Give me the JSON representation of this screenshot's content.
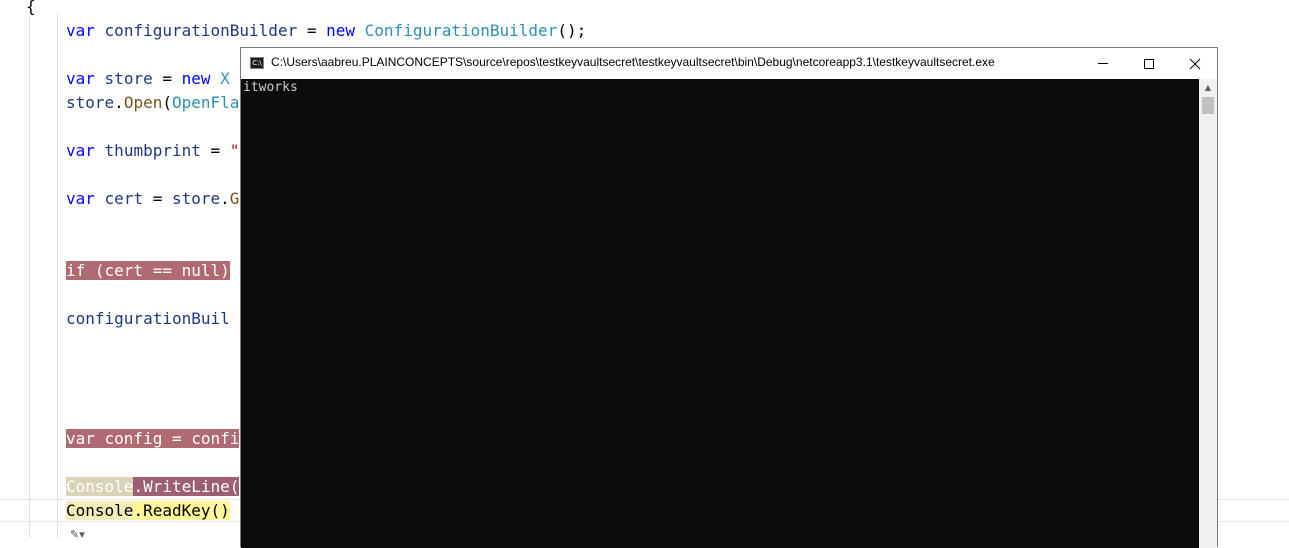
{
  "editor": {
    "open_brace": "{",
    "lines": {
      "l1": {
        "kw": "var",
        "ident": "configurationBuilder",
        "op": " = ",
        "kw2": "new",
        "type": "ConfigurationBuilder",
        "tail": "();"
      },
      "l2": {
        "kw": "var",
        "ident": "store",
        "op": " = ",
        "kw2": "new",
        "type": "X"
      },
      "l3": {
        "ident": "store",
        "dot": ".",
        "method": "Open",
        "paren": "(",
        "type": "OpenFla"
      },
      "l4": {
        "kw": "var",
        "ident": "thumbprint",
        "op": " = ",
        "str": "\""
      },
      "l5": {
        "kw": "var",
        "ident": "cert",
        "op": " = ",
        "ident2": "store",
        "dot": ".",
        "method": "G"
      },
      "l6": {
        "text": "if (cert == null)"
      },
      "l7": {
        "ident": "configurationBuil"
      },
      "l8": {
        "text": "var config = confi"
      },
      "l9": {
        "part1": "Console",
        "part2": ".WriteLine("
      },
      "l10": {
        "part1": "Console",
        "part2": ".ReadKey()"
      }
    }
  },
  "console_window": {
    "title": "C:\\Users\\aabreu.PLAINCONCEPTS\\source\\repos\\testkeyvaultsecret\\testkeyvaultsecret\\bin\\Debug\\netcoreapp3.1\\testkeyvaultsecret.exe",
    "icon_label": "C:\\",
    "output": "itworks"
  }
}
